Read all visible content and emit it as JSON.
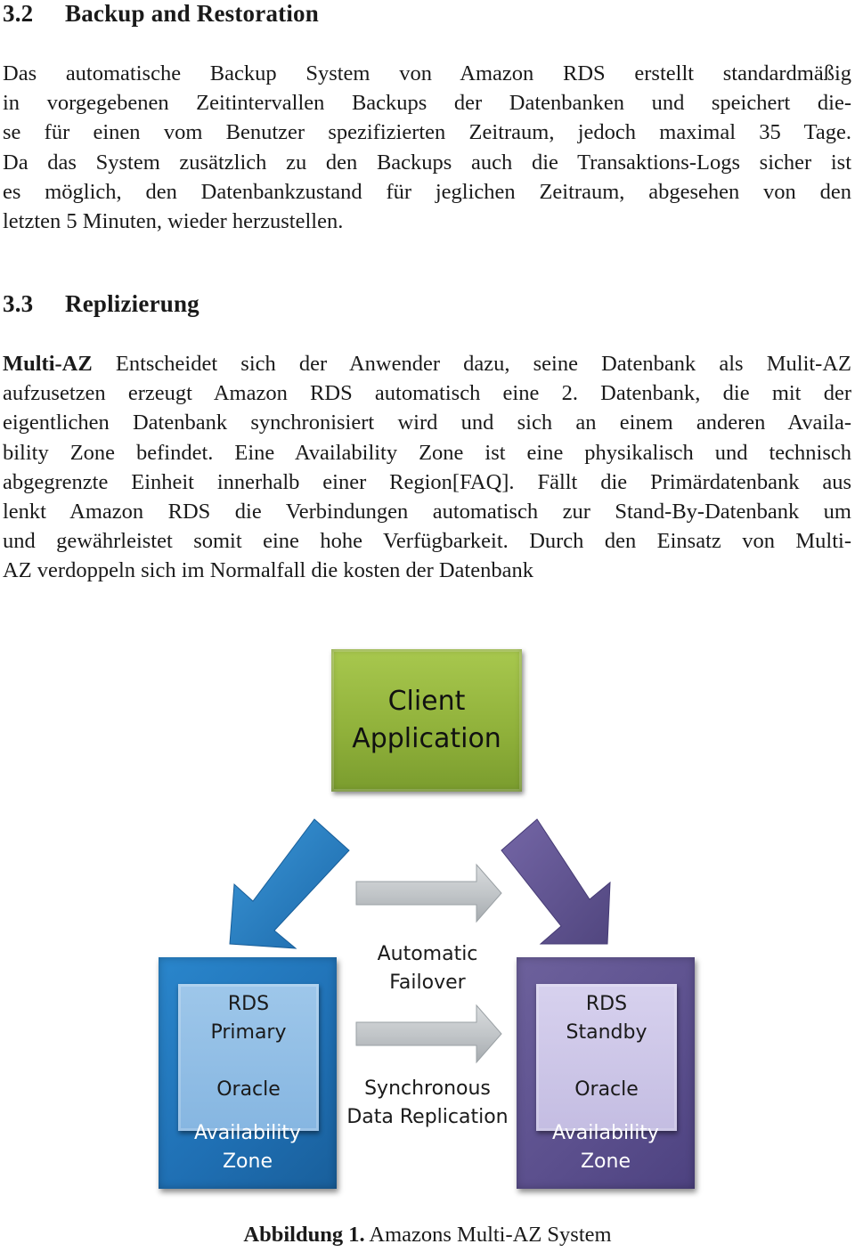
{
  "section_32": {
    "number": "3.2",
    "title": "Backup and Restoration",
    "lines": [
      "Das automatische Backup System von Amazon RDS erstellt standardmäßig",
      "in vorgegebenen Zeitintervallen Backups der Datenbanken und speichert die-",
      "se für einen vom Benutzer spezifizierten Zeitraum, jedoch maximal 35 Tage.",
      "Da das System zusätzlich zu den Backups auch die Transaktions-Logs sicher ist",
      "es möglich, den Datenbankzustand für jeglichen Zeitraum, abgesehen von den",
      "letzten 5 Minuten, wieder herzustellen."
    ]
  },
  "section_33": {
    "number": "3.3",
    "title": "Replizierung",
    "paragraph_label": "Multi-AZ",
    "first_line_rest": "Entscheidet sich der Anwender dazu, seine Datenbank als Mulit-AZ",
    "lines": [
      "aufzusetzen erzeugt Amazon RDS automatisch eine 2. Datenbank, die mit der",
      "eigentlichen Datenbank synchronisiert wird und sich an einem anderen Availa-",
      "bility Zone befindet. Eine Availability Zone ist eine physikalisch und technisch",
      "abgegrenzte Einheit innerhalb einer Region[FAQ]. Fällt die Primärdatenbank aus",
      "lenkt Amazon RDS die Verbindungen automatisch zur Stand-By-Datenbank um",
      "und gewährleistet somit eine hohe Verfügbarkeit. Durch den Einsatz von Multi-",
      "AZ verdoppeln sich im Normalfall die kosten der Datenbank"
    ]
  },
  "diagram": {
    "client": {
      "line1": "Client",
      "line2": "Application",
      "color": "#8fb03a"
    },
    "primary": {
      "line1": "RDS",
      "line2": "Primary",
      "engine": "Oracle",
      "zone1": "Availability",
      "zone2": "Zone",
      "color": "#1f6fb3",
      "inner_color": "#86b6e1"
    },
    "standby": {
      "line1": "RDS",
      "line2": "Standby",
      "engine": "Oracle",
      "zone1": "Availability",
      "zone2": "Zone",
      "color": "#5b4f8d",
      "inner_color": "#c4bde2"
    },
    "failover": {
      "line1": "Automatic",
      "line2": "Failover"
    },
    "replication": {
      "line1": "Synchronous",
      "line2": "Data Replication"
    },
    "arrow_gray": "#bfc3c6"
  },
  "caption": {
    "label": "Abbildung 1.",
    "text": "Amazons Multi-AZ System"
  }
}
